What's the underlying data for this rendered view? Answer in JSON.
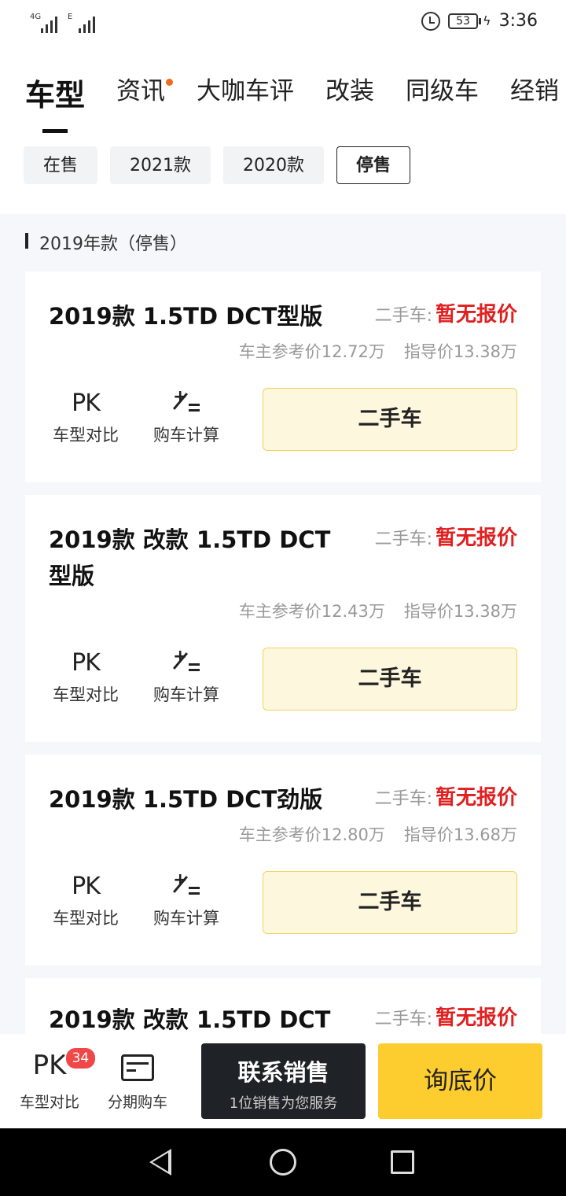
{
  "status": {
    "signal1_label": "4G",
    "signal2_label": "E",
    "battery": "53",
    "time": "3:36"
  },
  "tabs": [
    {
      "label": "车型",
      "active": true
    },
    {
      "label": "资讯",
      "dot": true
    },
    {
      "label": "大咖车评"
    },
    {
      "label": "改装"
    },
    {
      "label": "同级车"
    },
    {
      "label": "经销"
    }
  ],
  "filters": [
    "在售",
    "2021款",
    "2020款",
    "停售"
  ],
  "section": {
    "title": "2019年款（停售）"
  },
  "cards": [
    {
      "name": "2019款 1.5TD DCT型版",
      "used_label": "二手车:",
      "used_price": "暂无报价",
      "owner_price": "车主参考价12.72万",
      "guide_price": "指导价13.38万",
      "pk_icon": "PK",
      "compare_label": "车型对比",
      "calc_label": "购车计算",
      "used_btn": "二手车"
    },
    {
      "name": "2019款 改款 1.5TD DCT型版",
      "used_label": "二手车:",
      "used_price": "暂无报价",
      "owner_price": "车主参考价12.43万",
      "guide_price": "指导价13.38万",
      "pk_icon": "PK",
      "compare_label": "车型对比",
      "calc_label": "购车计算",
      "used_btn": "二手车"
    },
    {
      "name": "2019款 1.5TD DCT劲版",
      "used_label": "二手车:",
      "used_price": "暂无报价",
      "owner_price": "车主参考价12.80万",
      "guide_price": "指导价13.68万",
      "pk_icon": "PK",
      "compare_label": "车型对比",
      "calc_label": "购车计算",
      "used_btn": "二手车"
    },
    {
      "name": "2019款 改款 1.5TD DCT",
      "used_label": "二手车:",
      "used_price": "暂无报价"
    }
  ],
  "bottom": {
    "compare_icon": "PK",
    "compare_badge": "34",
    "compare_label": "车型对比",
    "installment_label": "分期购车",
    "contact_main": "联系销售",
    "contact_sub": "1位销售为您服务",
    "ask_price": "询底价"
  }
}
